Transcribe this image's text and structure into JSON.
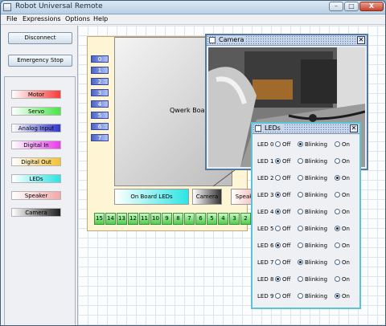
{
  "window": {
    "title": "Robot Universal Remote",
    "controls": {
      "minimize": "–",
      "maximize": "□",
      "close": "X"
    }
  },
  "menu": [
    "File",
    "Expressions",
    "Options",
    "Help"
  ],
  "left_panel": {
    "disconnect_label": "Disconnect",
    "emergency_stop_label": "Emergency Stop",
    "tools": [
      {
        "label": "Motor",
        "color": "#f83a3a"
      },
      {
        "label": "Servo",
        "color": "#46e646"
      },
      {
        "label": "Analog Input",
        "color": "#2f34d0"
      },
      {
        "label": "Digital In",
        "color": "#e93ae9"
      },
      {
        "label": "Digital Out",
        "color": "#f3c132"
      },
      {
        "label": "LEDs",
        "color": "#2de4e4"
      },
      {
        "label": "Speaker",
        "color": "#f3a8a8"
      },
      {
        "label": "Camera",
        "color": "#1e1e1e"
      }
    ]
  },
  "board": {
    "label": "Qwerk Board",
    "ports": [
      "0",
      "1",
      "2",
      "3",
      "4",
      "5",
      "6",
      "7"
    ],
    "on_board_leds_label": "On Board LEDs",
    "camera_label": "Camera",
    "speaker_label": "Speaker",
    "pins": [
      "15",
      "14",
      "13",
      "12",
      "11",
      "10",
      "9",
      "8",
      "7",
      "6",
      "5",
      "4",
      "3",
      "2"
    ]
  },
  "camera_window": {
    "title": "Camera"
  },
  "leds_window": {
    "title": "LEDs",
    "options": [
      "Off",
      "Blinking",
      "On"
    ],
    "rows": [
      {
        "name": "LED 0",
        "selected": "Blinking"
      },
      {
        "name": "LED 1",
        "selected": "Off"
      },
      {
        "name": "LED 2",
        "selected": "On"
      },
      {
        "name": "LED 3",
        "selected": "Off"
      },
      {
        "name": "LED 4",
        "selected": "Off"
      },
      {
        "name": "LED 5",
        "selected": "On"
      },
      {
        "name": "LED 6",
        "selected": "Off"
      },
      {
        "name": "LED 7",
        "selected": "Blinking"
      },
      {
        "name": "LED 8",
        "selected": "Off"
      },
      {
        "name": "LED 9",
        "selected": "On"
      }
    ]
  }
}
